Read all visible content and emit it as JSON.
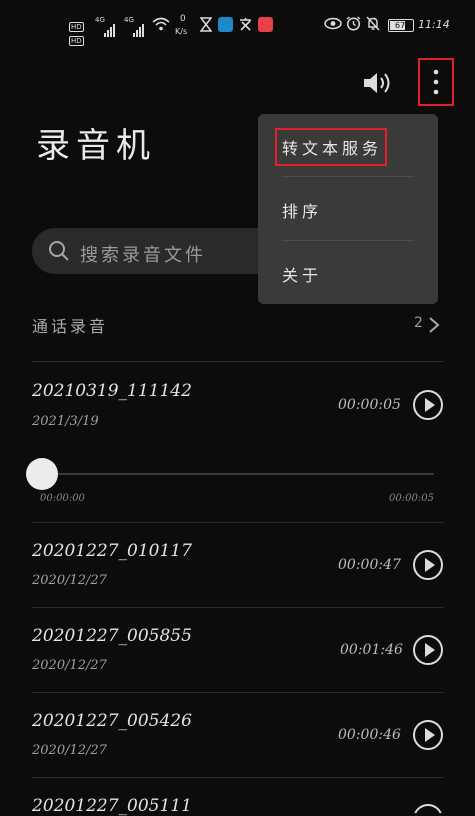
{
  "status_bar": {
    "net_speed_value": "0",
    "net_speed_unit": "K/s",
    "signal_1": "4G",
    "signal_2": "4G",
    "hd_1": "HD",
    "hd_2": "HD",
    "battery": "67",
    "time": "11:14"
  },
  "header": {
    "title": "录音机"
  },
  "search": {
    "placeholder": "搜索录音文件"
  },
  "call_recordings": {
    "label": "通话录音",
    "count": "2"
  },
  "recordings": [
    {
      "name": "20210319_111142",
      "date": "2021/3/19",
      "duration": "00:00:05"
    },
    {
      "name": "20201227_010117",
      "date": "2020/12/27",
      "duration": "00:00:47"
    },
    {
      "name": "20201227_005855",
      "date": "2020/12/27",
      "duration": "00:01:46"
    },
    {
      "name": "20201227_005426",
      "date": "2020/12/27",
      "duration": "00:00:46"
    },
    {
      "name": "20201227_005111",
      "date": "",
      "duration": ""
    }
  ],
  "player": {
    "elapsed": "00:00:00",
    "total": "00:00:05",
    "progress": 0
  },
  "menu": {
    "items": [
      "转文本服务",
      "排序",
      "关于"
    ]
  },
  "colors": {
    "background": "#0c0c0c",
    "menu_bg": "#3a3a3a",
    "highlight": "#e0202a"
  }
}
